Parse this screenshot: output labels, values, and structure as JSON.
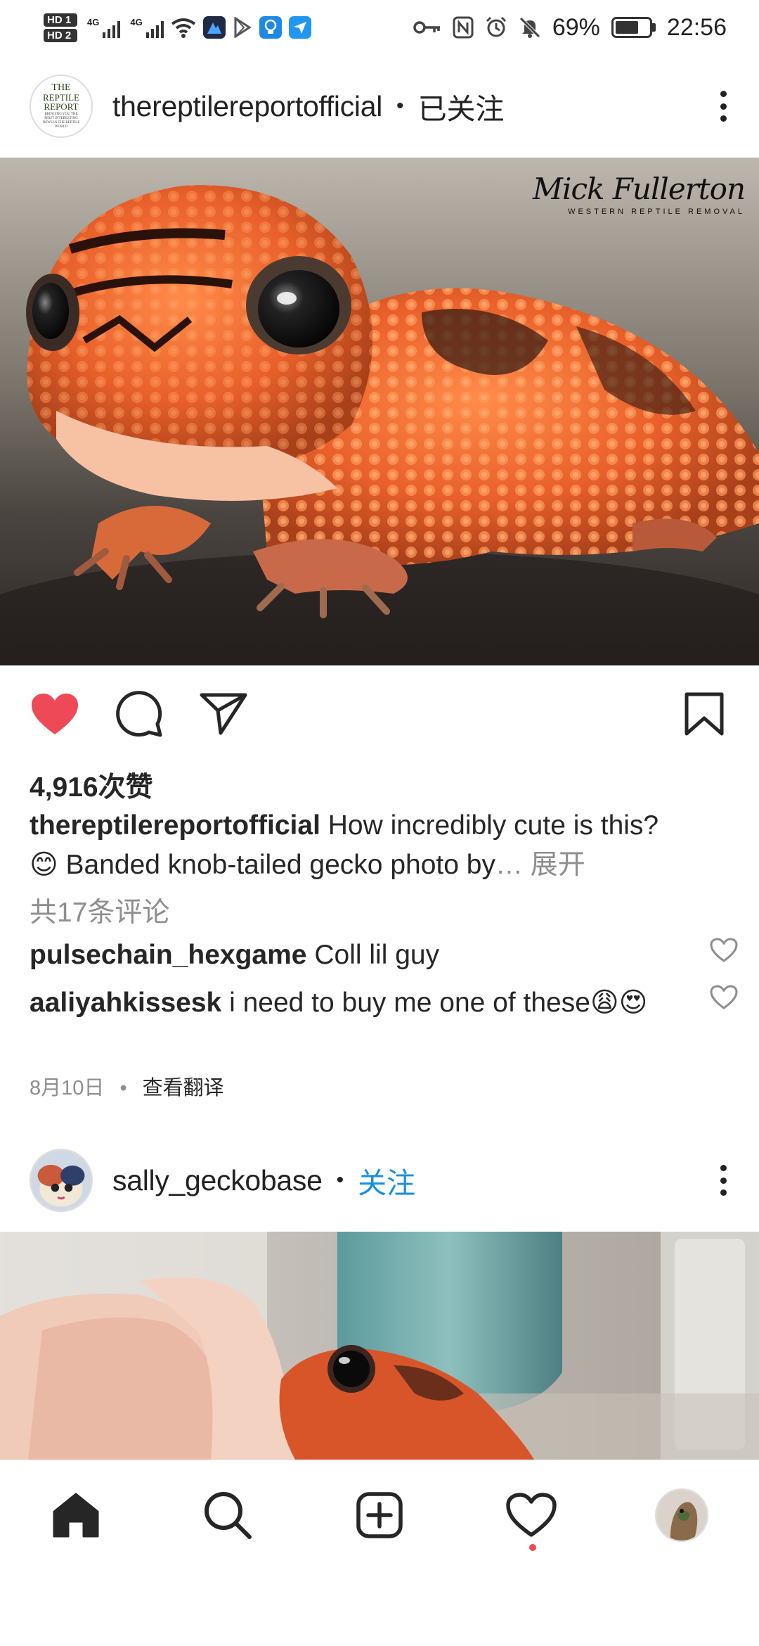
{
  "status_bar": {
    "left_badges": [
      "HD 1",
      "HD 2"
    ],
    "network_1": "4G",
    "network_2": "4G",
    "battery_percent": "69%",
    "battery_level": 0.69,
    "time": "22:56",
    "icons": [
      "wifi-icon",
      "app-icon-dark",
      "play-store-icon",
      "bulb-app-icon",
      "mail-app-icon",
      "key-icon",
      "nfc-icon",
      "alarm-icon",
      "mute-icon"
    ]
  },
  "post1": {
    "avatar_text": {
      "line1": "THE",
      "line2": "REPTILE",
      "line3": "REPORT",
      "tagline": "BRINGING YOU THE MOST INTERESTING NEWS IN THE REPTILE WORLD"
    },
    "username": "thereptilereportofficial",
    "separator": "•",
    "follow_state": "已关注",
    "watermark_name": "Mick Fullerton",
    "watermark_sub": "WESTERN REPTILE REMOVAL",
    "liked": true,
    "likes": "4,916次赞",
    "caption_user": "thereptilereportofficial",
    "caption_line1": "How incredibly cute is this?",
    "caption_line2": "😊 Banded knob-tailed gecko photo by",
    "caption_ellipsis": "…",
    "caption_more": "展开",
    "comments_link": "共17条评论",
    "comments": [
      {
        "user": "pulsechain_hexgame",
        "text": "Coll lil guy"
      },
      {
        "user": "aaliyahkissesk",
        "text": "i need to buy me one of these😩😍"
      }
    ],
    "date": "8月10日",
    "date_sep": "•",
    "translate": "查看翻译"
  },
  "post2": {
    "username": "sally_geckobase",
    "separator": "•",
    "follow_label": "关注"
  },
  "bottom_nav": {
    "items": [
      "home-icon",
      "search-icon",
      "create-icon",
      "activity-icon",
      "profile-avatar"
    ],
    "activity_has_notification": true
  },
  "colors": {
    "like_red": "#ed4956",
    "follow_blue": "#1a8fe0",
    "secondary_text": "#8e8e8e",
    "primary_text": "#262626"
  }
}
